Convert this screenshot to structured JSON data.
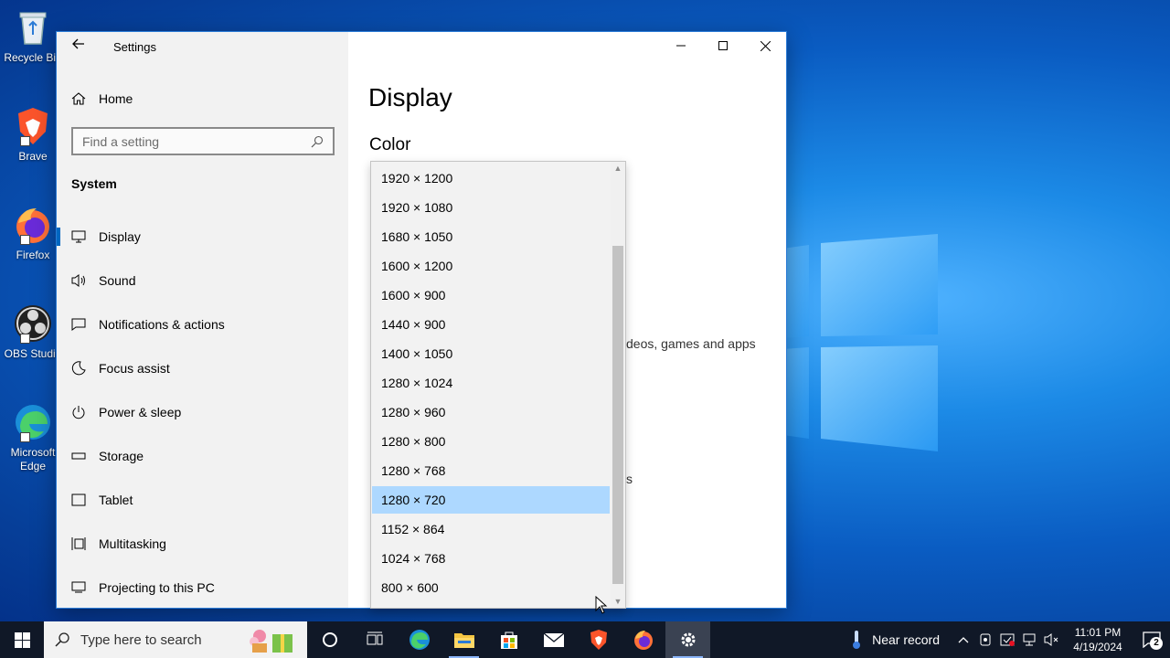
{
  "desktop": {
    "icons": [
      {
        "label": "Recycle Bin",
        "icon": "recycle-bin-icon"
      },
      {
        "label": "Brave",
        "icon": "brave-icon"
      },
      {
        "label": "Firefox",
        "icon": "firefox-icon"
      },
      {
        "label": "OBS Studio",
        "icon": "obs-studio-icon"
      },
      {
        "label": "Microsoft Edge",
        "icon": "edge-icon"
      }
    ]
  },
  "window": {
    "title": "Settings",
    "sidebar": {
      "home_label": "Home",
      "search_placeholder": "Find a setting",
      "section_label": "System",
      "items": [
        {
          "label": "Display",
          "icon": "monitor-icon",
          "active": true
        },
        {
          "label": "Sound",
          "icon": "speaker-icon"
        },
        {
          "label": "Notifications & actions",
          "icon": "notification-icon"
        },
        {
          "label": "Focus assist",
          "icon": "moon-icon"
        },
        {
          "label": "Power & sleep",
          "icon": "power-icon"
        },
        {
          "label": "Storage",
          "icon": "storage-icon"
        },
        {
          "label": "Tablet",
          "icon": "tablet-icon"
        },
        {
          "label": "Multitasking",
          "icon": "multitasking-icon"
        },
        {
          "label": "Projecting to this PC",
          "icon": "projecting-icon"
        }
      ]
    },
    "content": {
      "page_title": "Display",
      "subhead": "Color",
      "partial_text": "deos, games and apps",
      "partial_mark": "s"
    }
  },
  "resolution_dropdown": {
    "options": [
      "1920 × 1200",
      "1920 × 1080",
      "1680 × 1050",
      "1600 × 1200",
      "1600 × 900",
      "1440 × 900",
      "1400 × 1050",
      "1280 × 1024",
      "1280 × 960",
      "1280 × 800",
      "1280 × 768",
      "1280 × 720",
      "1152 × 864",
      "1024 × 768",
      "800 × 600"
    ],
    "selected": "1280 × 720"
  },
  "taskbar": {
    "search_placeholder": "Type here to search",
    "apps": [
      {
        "name": "cortana",
        "icon": "cortana-circle-icon"
      },
      {
        "name": "task-view",
        "icon": "task-view-icon"
      },
      {
        "name": "edge",
        "icon": "edge-icon"
      },
      {
        "name": "file-explorer",
        "icon": "folder-icon"
      },
      {
        "name": "microsoft-store",
        "icon": "store-icon"
      },
      {
        "name": "mail",
        "icon": "mail-icon"
      },
      {
        "name": "brave",
        "icon": "brave-icon"
      },
      {
        "name": "firefox",
        "icon": "firefox-icon"
      },
      {
        "name": "settings",
        "icon": "gear-icon"
      }
    ],
    "weather_text": "Near record",
    "clock_time": "11:01 PM",
    "clock_date": "4/19/2024",
    "notification_count": "2"
  },
  "colors": {
    "accent": "#0067c0",
    "selected_row": "#add8ff",
    "taskbar": "#101827"
  }
}
